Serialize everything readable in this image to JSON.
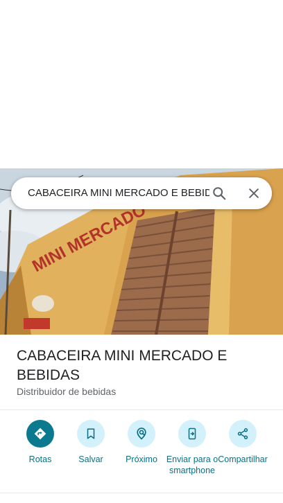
{
  "search": {
    "query": "CABACEIRA MINI MERCADO E BEBIDAS",
    "search_icon": "search-icon",
    "close_icon": "close-icon"
  },
  "place": {
    "photo_sign_text": "MINI MERCADO",
    "title": "CABACEIRA MINI MERCADO E BEBIDAS",
    "category": "Distribuidor de bebidas"
  },
  "actions": [
    {
      "label": "Rotas",
      "icon": "directions-icon"
    },
    {
      "label": "Salvar",
      "icon": "bookmark-icon"
    },
    {
      "label": "Próximo",
      "icon": "nearby-icon"
    },
    {
      "label": "Enviar para o smartphone",
      "icon": "send-to-phone-icon"
    },
    {
      "label": "Compartilhar",
      "icon": "share-icon"
    }
  ],
  "colors": {
    "accent": "#0b7a8f",
    "accent_text": "#0b6f83",
    "action_bg": "#d2f1fb"
  }
}
